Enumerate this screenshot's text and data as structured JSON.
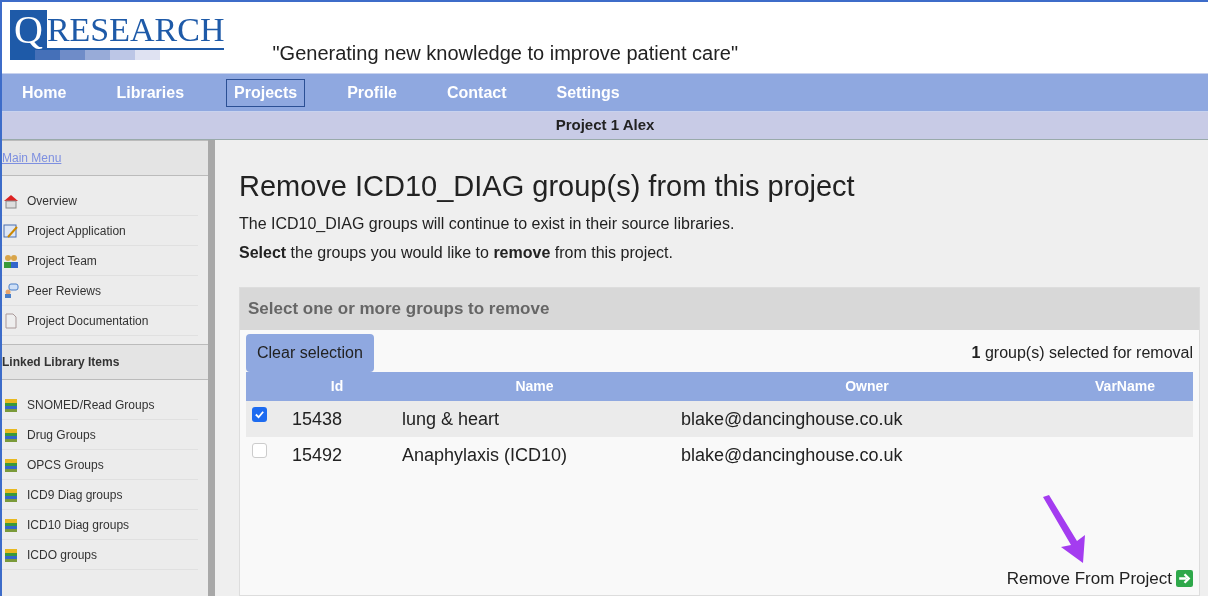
{
  "logo": {
    "letter": "Q",
    "word": "RESEARCH"
  },
  "tagline": "\"Generating new knowledge to improve patient care\"",
  "nav": [
    {
      "label": "Home",
      "selected": false
    },
    {
      "label": "Libraries",
      "selected": false
    },
    {
      "label": "Projects",
      "selected": true
    },
    {
      "label": "Profile",
      "selected": false
    },
    {
      "label": "Contact",
      "selected": false
    },
    {
      "label": "Settings",
      "selected": false
    }
  ],
  "project_bar": "Project 1 Alex",
  "sidebar": {
    "sections": [
      {
        "title": "Main Menu",
        "kind": "link",
        "items": [
          {
            "label": "Overview",
            "kind": "house"
          },
          {
            "label": "Project Application",
            "kind": "form"
          },
          {
            "label": "Project Team",
            "kind": "people"
          },
          {
            "label": "Peer Reviews",
            "kind": "chat"
          },
          {
            "label": "Project Documentation",
            "kind": "document"
          }
        ]
      },
      {
        "title": "Linked Library Items",
        "kind": "heading",
        "items": [
          {
            "label": "SNOMED/Read Groups",
            "kind": "books"
          },
          {
            "label": "Drug Groups",
            "kind": "books"
          },
          {
            "label": "OPCS Groups",
            "kind": "books"
          },
          {
            "label": "ICD9 Diag groups",
            "kind": "books"
          },
          {
            "label": "ICD10 Diag groups",
            "kind": "books"
          },
          {
            "label": "ICDO groups",
            "kind": "books"
          }
        ]
      }
    ]
  },
  "heading": "Remove ICD10_DIAG group(s) from this project",
  "description": [
    "The ICD10_DIAG groups will continue to exist in their source libraries.",
    "**Select** the groups you would like to **remove** from this project."
  ],
  "panel": {
    "title": "Select one or more groups to remove",
    "clear_button": "Clear selection",
    "selection_count": "**1** group(s) selected for removal",
    "table": {
      "columns": [
        "Id",
        "Name",
        "Owner",
        "VarName"
      ],
      "rows": [
        {
          "checked": true,
          "cells": [
            "15438",
            "lung & heart",
            "blake@dancinghouse.co.uk"
          ]
        },
        {
          "checked": false,
          "cells": [
            "15492",
            "Anaphylaxis (ICD10)",
            "blake@dancinghouse.co.uk"
          ]
        }
      ]
    },
    "remove_link": "Remove From Project"
  }
}
